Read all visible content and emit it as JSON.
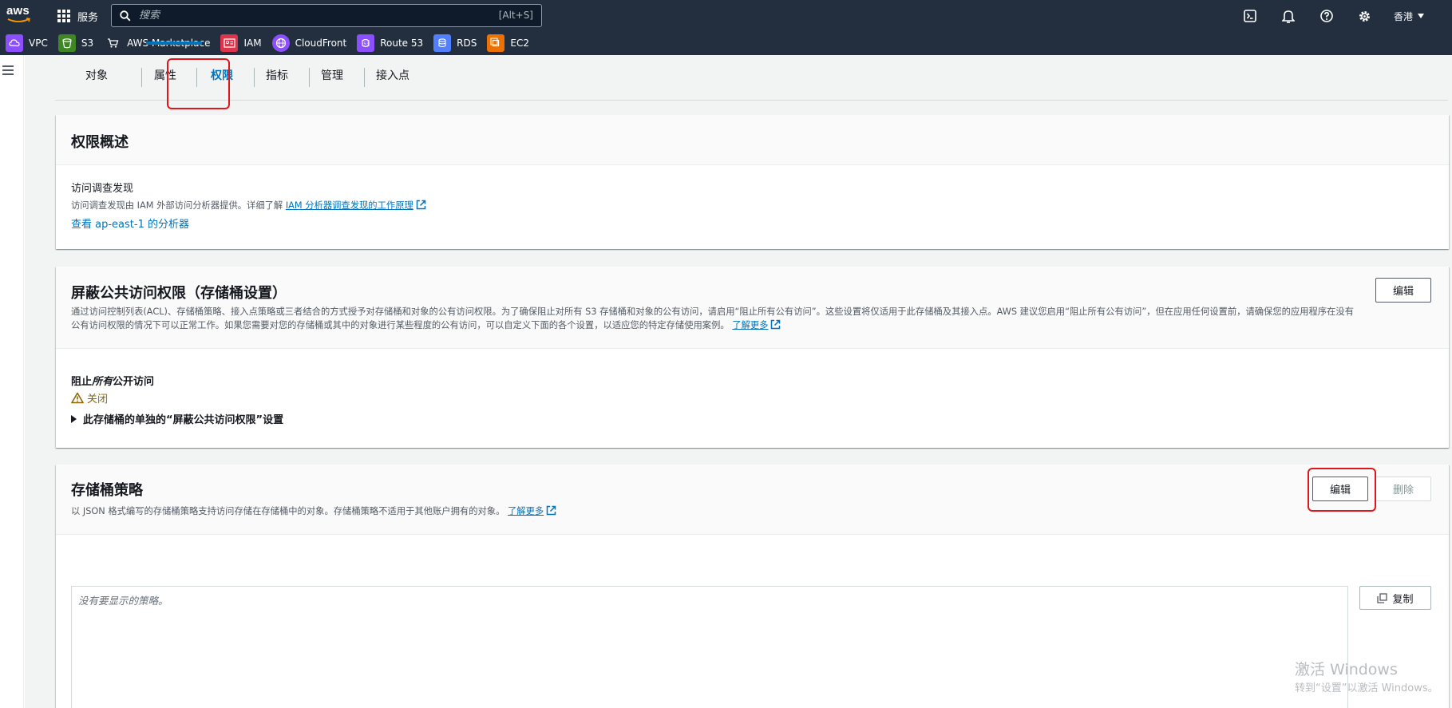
{
  "topnav": {
    "logo_text": "aws",
    "services_label": "服务",
    "search_placeholder": "搜索",
    "search_shortcut": "[Alt+S]",
    "region": "香港",
    "icons": [
      "cloudshell-icon",
      "notifications-bell-icon",
      "help-icon",
      "settings-gear-icon"
    ]
  },
  "favorites": [
    {
      "label": "VPC",
      "icon": "vpc-icon",
      "color": "#8c4fff"
    },
    {
      "label": "S3",
      "icon": "s3-bucket-icon",
      "color": "#3f8624"
    },
    {
      "label": "AWS Marketplace",
      "icon": "marketplace-cart-icon",
      "color": "#232f3e"
    },
    {
      "label": "IAM",
      "icon": "iam-id-card-icon",
      "color": "#dd344c"
    },
    {
      "label": "CloudFront",
      "icon": "cloudfront-icon",
      "color": "#8c4fff"
    },
    {
      "label": "Route 53",
      "icon": "route53-icon",
      "color": "#8c4fff"
    },
    {
      "label": "RDS",
      "icon": "rds-icon",
      "color": "#527fff"
    },
    {
      "label": "EC2",
      "icon": "ec2-chip-icon",
      "color": "#ed7100"
    }
  ],
  "tabs": [
    {
      "label": "对象",
      "active": false
    },
    {
      "label": "属性",
      "active": false
    },
    {
      "label": "权限",
      "active": true
    },
    {
      "label": "指标",
      "active": false
    },
    {
      "label": "管理",
      "active": false
    },
    {
      "label": "接入点",
      "active": false
    }
  ],
  "overview": {
    "title": "权限概述",
    "section_label": "访问调查发现",
    "desc_prefix": "访问调查发现由 IAM 外部访问分析器提供。详细了解",
    "desc_link": "IAM 分析器调查发现的工作原理",
    "analyzer_link": "查看 ap-east-1 的分析器"
  },
  "block_public": {
    "title": "屏蔽公共访问权限（存储桶设置）",
    "edit_label": "编辑",
    "desc_line1": "通过访问控制列表(ACL)、存储桶策略、接入点策略或三者结合的方式授予对存储桶和对象的公有访问权限。为了确保阻止对所有 S3 存储桶和对象的公有访问，请启用“阻止所有公有访问”。这些设置将仅适用于此存储桶及其接入点。AWS 建议您启用“阻止所有公有访问”，但在应用任何设置前，请确保您的应用程序在没有",
    "desc_line2": "公有访问权限的情况下可以正常工作。如果您需要对您的存储桶或其中的对象进行某些程度的公有访问，可以自定义下面的各个设置，以适应您的特定存储使用案例。",
    "learn_more": "了解更多",
    "block_all_prefix": "阻止",
    "block_all_em": "所有",
    "block_all_suffix": "公开访问",
    "status": "关闭",
    "expander": "此存储桶的单独的“屏蔽公共访问权限”设置"
  },
  "bucket_policy": {
    "title": "存储桶策略",
    "edit_label": "编辑",
    "delete_label": "删除",
    "desc": "以 JSON 格式编写的存储桶策略支持访问存储在存储桶中的对象。存储桶策略不适用于其他账户拥有的对象。",
    "learn_more": "了解更多",
    "empty_text": "没有要显示的策略。",
    "copy_label": "复制"
  },
  "watermark": {
    "line1": "激活 Windows",
    "line2": "转到“设置”以激活 Windows。"
  }
}
